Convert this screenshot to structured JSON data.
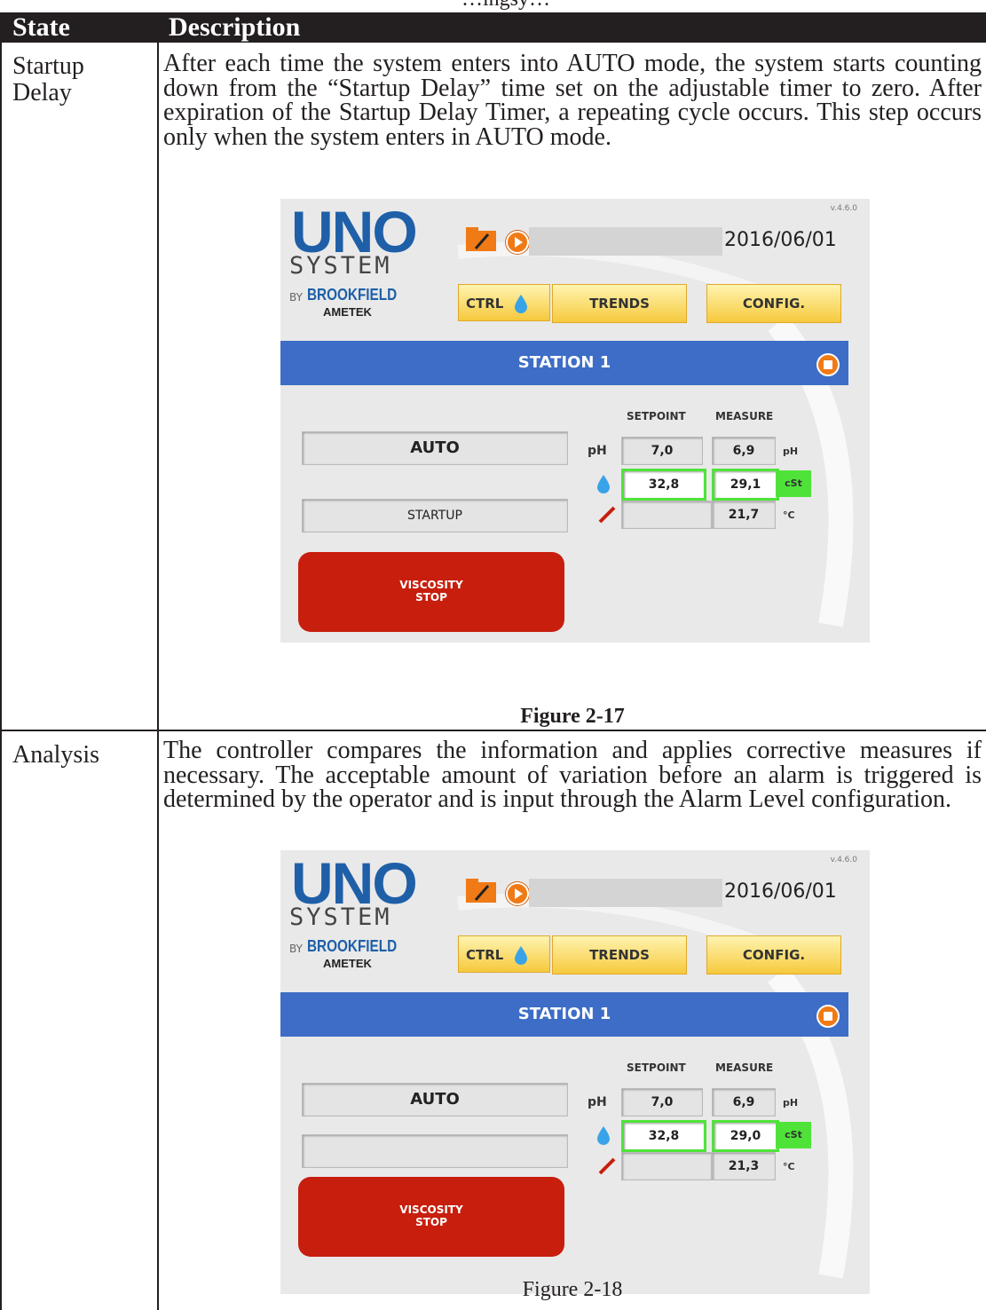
{
  "cut_text": "…ingsy…",
  "table": {
    "header": {
      "state": "State",
      "description": "Description"
    },
    "rows": [
      {
        "state_line1": "Startup",
        "state_line2": "Delay",
        "description": "After each time the system enters into AUTO mode, the system starts counting down from the “Startup Delay” time set on the adjustable timer to zero. After expiration of the Startup Delay Timer, a repeating cycle occurs. This step occurs only when the system enters in AUTO mode.",
        "caption": "Figure 2-17",
        "screen": {
          "logo_top": "UNO",
          "logo_bottom": "SYSTEM",
          "by": "BY",
          "brand": "BROOKFIELD",
          "brand2": "AMETEK",
          "version": "v.4.6.0",
          "date": "2016/06/01",
          "tabs": [
            "CTRL",
            "TRENDS",
            "CONFIG."
          ],
          "station": "STATION 1",
          "mode": "AUTO",
          "status": "STARTUP",
          "setpoint_header": "SETPOINT",
          "measure_header": "MEASURE",
          "ph_label": "pH",
          "ph_setpoint": "7,0",
          "ph_measure": "6,9",
          "ph_unit": "pH",
          "visc_setpoint": "32,8",
          "visc_measure": "29,1",
          "visc_unit": "cSt",
          "temp_measure": "21,7",
          "temp_unit": "°C",
          "stop_line1": "VISCOSITY",
          "stop_line2": "STOP"
        }
      },
      {
        "state_line1": "Analysis",
        "state_line2": "",
        "description": "The controller compares the information and applies corrective measures if necessary. The acceptable amount of variation before an alarm is triggered is determined by the operator and is input through the Alarm Level configuration.",
        "caption": "Figure 2-18",
        "screen": {
          "logo_top": "UNO",
          "logo_bottom": "SYSTEM",
          "by": "BY",
          "brand": "BROOKFIELD",
          "brand2": "AMETEK",
          "version": "v.4.6.0",
          "date": "2016/06/01",
          "tabs": [
            "CTRL",
            "TRENDS",
            "CONFIG."
          ],
          "station": "STATION 1",
          "mode": "AUTO",
          "status": "",
          "setpoint_header": "SETPOINT",
          "measure_header": "MEASURE",
          "ph_label": "pH",
          "ph_setpoint": "7,0",
          "ph_measure": "6,9",
          "ph_unit": "pH",
          "visc_setpoint": "32,8",
          "visc_measure": "29,0",
          "visc_unit": "cSt",
          "temp_measure": "21,3",
          "temp_unit": "°C",
          "stop_line1": "VISCOSITY",
          "stop_line2": "STOP"
        }
      }
    ]
  },
  "colors": {
    "station_bar": "#3d6dc6",
    "tab": "#f6c93d",
    "ok_green": "#4fe33a",
    "stop_red": "#c81e0d",
    "accent_orange": "#f07a15"
  }
}
